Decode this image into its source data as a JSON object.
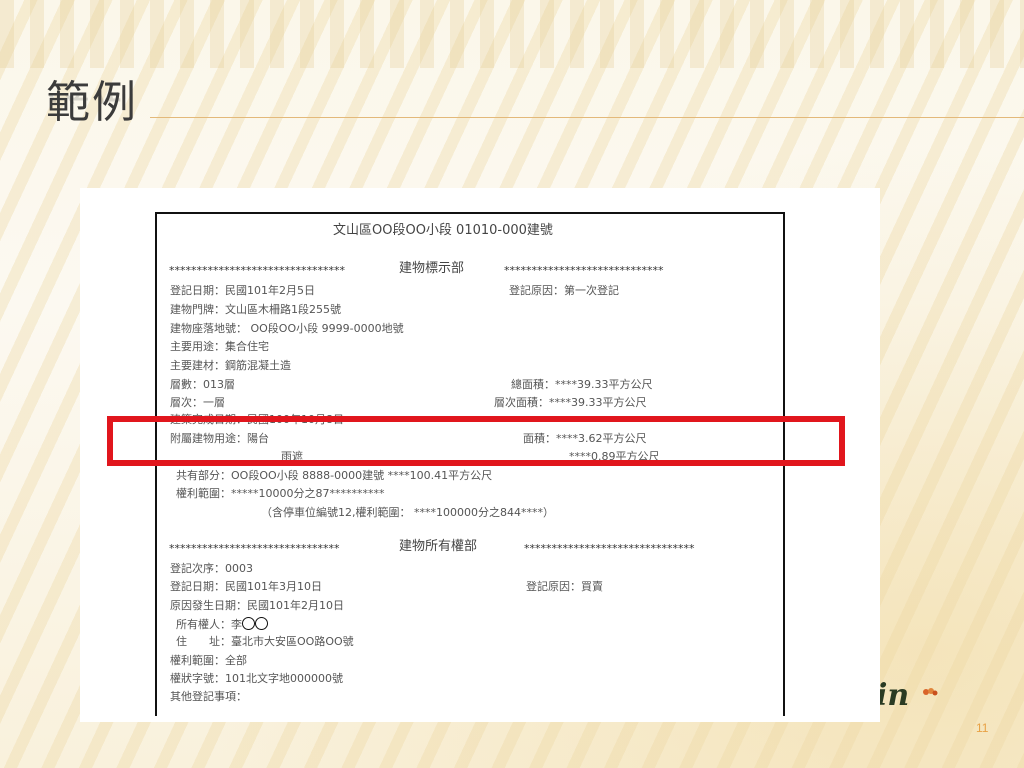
{
  "slide": {
    "title": "範例",
    "page_number": "11",
    "logo_text": "in"
  },
  "document": {
    "heading": "文山區OO段OO小段 01010-000建號",
    "section1_stars_left": "********************************",
    "section1_title": "建物標示部",
    "section1_stars_right": "*****************************",
    "reg_date": "登記日期：民國101年2月5日",
    "reg_reason": "登記原因：第一次登記",
    "address": "建物門牌：文山區木柵路1段255號",
    "land_no": "建物座落地號： OO段OO小段 9999-0000地號",
    "main_use": "主要用途：集合住宅",
    "main_material": "主要建材：鋼筋混凝土造",
    "floors": "層數：013層",
    "total_area": "總面積：****39.33平方公尺",
    "floor_level": "層次：一層",
    "floor_area": "層次面積：****39.33平方公尺",
    "built_date": "建築完成日期：民國100年10月8日",
    "attached_use": "附屬建物用途：陽台",
    "attached_area_label": "面積：****3.62平方公尺",
    "attached_use2": "雨遮",
    "attached_area2": "****0.89平方公尺",
    "common_part": "共有部分：OO段OO小段 8888-0000建號 ****100.41平方公尺",
    "rights_scope": "權利範圍：*****10000分之87**********",
    "parking_note": "（含停車位編號12,權利範圍： ****100000分之844****）",
    "section2_stars_left": "*******************************",
    "section2_title": "建物所有權部",
    "section2_stars_right": "*******************************",
    "reg_order": "登記次序：0003",
    "reg_date2": "登記日期：民國101年3月10日",
    "reg_reason2": "登記原因：買賣",
    "cause_date": "原因發生日期：民國101年2月10日",
    "owner_label": "所有權人：李",
    "owner_addr": "住　　址：臺北市大安區OO路OO號",
    "rights_scope2": "權利範圍：全部",
    "cert_no": "權狀字號：101北文字地000000號",
    "other_items": "其他登記事項："
  }
}
